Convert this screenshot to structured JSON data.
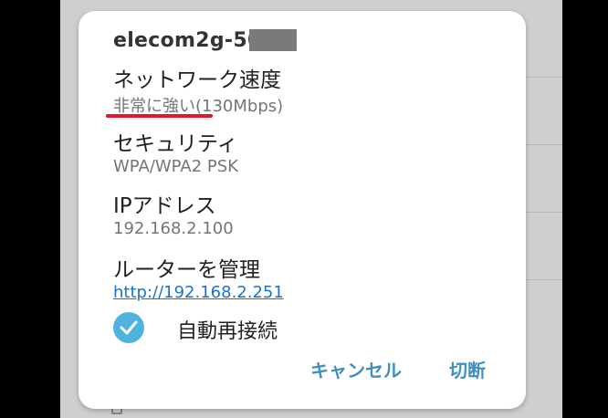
{
  "dialog": {
    "ssid": "elecom2g-50",
    "network_speed": {
      "label": "ネットワーク速度",
      "value": "非常に強い(130Mbps)"
    },
    "security": {
      "label": "セキュリティ",
      "value": "WPA/WPA2 PSK"
    },
    "ip_address": {
      "label": "IPアドレス",
      "value": "192.168.2.100"
    },
    "router": {
      "label": "ルーターを管理",
      "link": "http://192.168.2.251"
    },
    "auto_reconnect": {
      "label": "自動再接続",
      "checked": true
    },
    "buttons": {
      "cancel": "キャンセル",
      "disconnect": "切断"
    }
  },
  "colors": {
    "accent": "#3f8fbf",
    "checkbox": "#4fb3e0",
    "annotation_underline": "#e0192e",
    "link": "#1a73c8"
  }
}
